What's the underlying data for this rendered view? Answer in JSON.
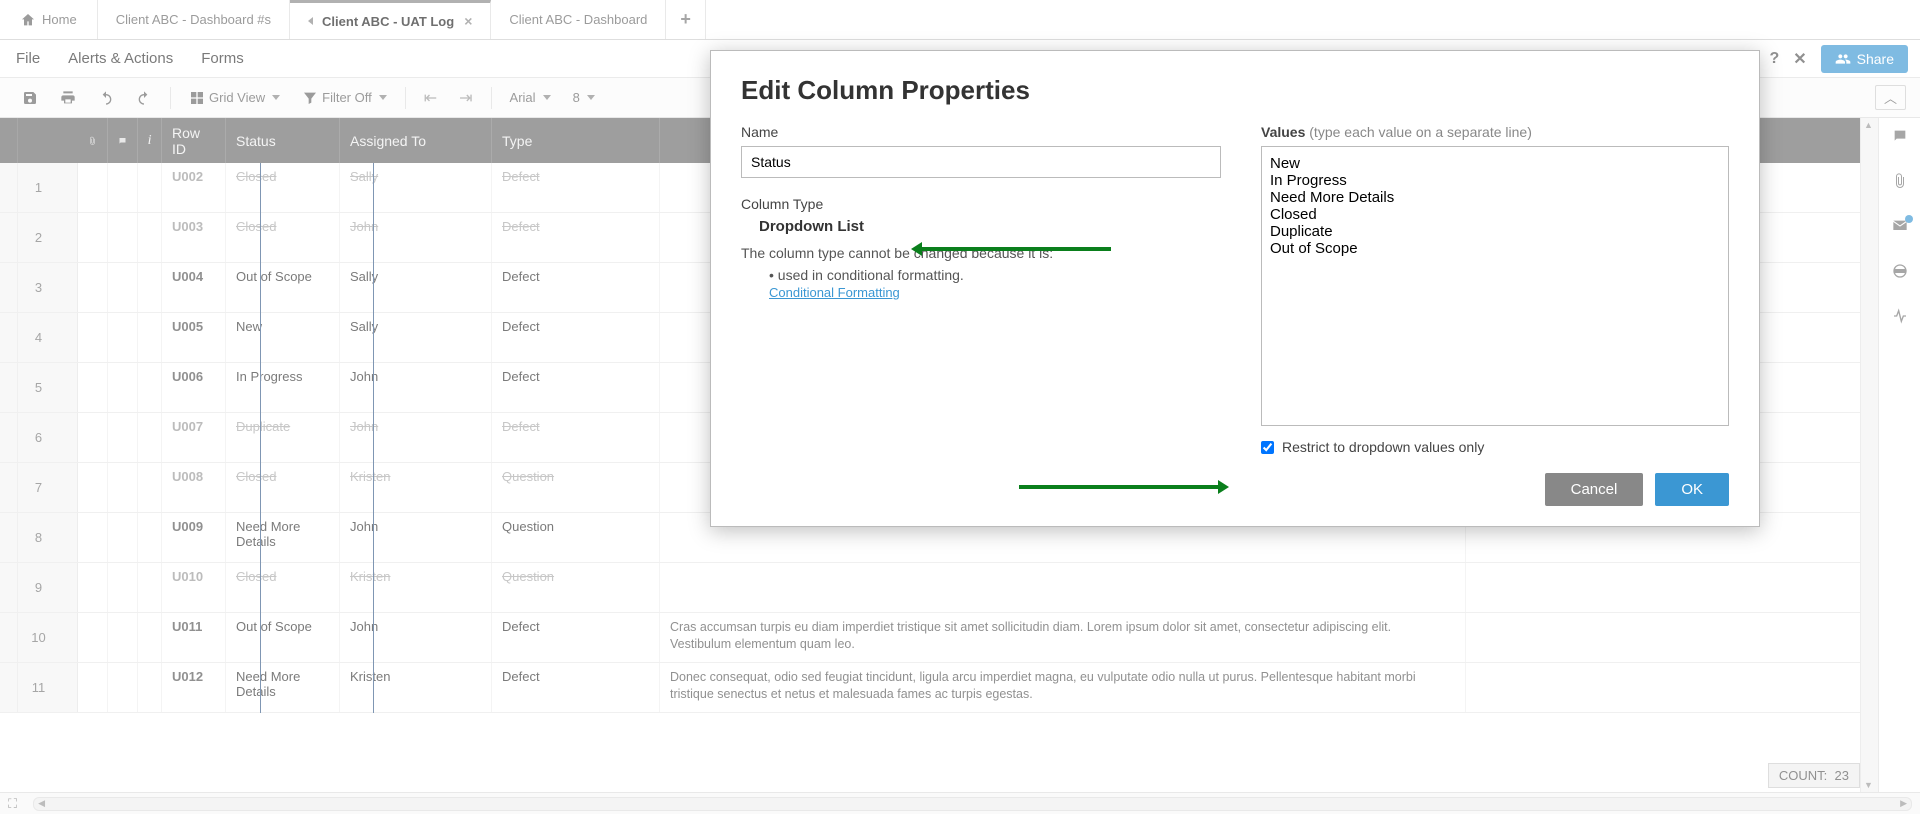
{
  "tabs": {
    "home": "Home",
    "t1": "Client ABC - Dashboard #s",
    "t2": "Client ABC - UAT Log",
    "t3": "Client ABC - Dashboard"
  },
  "menu": {
    "file": "File",
    "alerts": "Alerts & Actions",
    "forms": "Forms",
    "share": "Share"
  },
  "toolbar": {
    "grid_view": "Grid View",
    "filter_off": "Filter Off",
    "font": "Arial",
    "size": "8"
  },
  "headers": {
    "rowid": "Row ID",
    "status": "Status",
    "assigned": "Assigned To",
    "type": "Type"
  },
  "rows": [
    {
      "n": "1",
      "id": "U002",
      "status": "Closed",
      "assigned": "Sally",
      "type": "Defect",
      "closed": true,
      "desc": ""
    },
    {
      "n": "2",
      "id": "U003",
      "status": "Closed",
      "assigned": "John",
      "type": "Defect",
      "closed": true,
      "desc": ""
    },
    {
      "n": "3",
      "id": "U004",
      "status": "Out of Scope",
      "assigned": "Sally",
      "type": "Defect",
      "closed": false,
      "desc": ""
    },
    {
      "n": "4",
      "id": "U005",
      "status": "New",
      "assigned": "Sally",
      "type": "Defect",
      "closed": false,
      "desc": ""
    },
    {
      "n": "5",
      "id": "U006",
      "status": "In Progress",
      "assigned": "John",
      "type": "Defect",
      "closed": false,
      "desc": ""
    },
    {
      "n": "6",
      "id": "U007",
      "status": "Duplicate",
      "assigned": "John",
      "type": "Defect",
      "closed": true,
      "desc": ""
    },
    {
      "n": "7",
      "id": "U008",
      "status": "Closed",
      "assigned": "Kristen",
      "type": "Question",
      "closed": true,
      "desc": ""
    },
    {
      "n": "8",
      "id": "U009",
      "status": "Need More Details",
      "assigned": "John",
      "type": "Question",
      "closed": false,
      "desc": ""
    },
    {
      "n": "9",
      "id": "U010",
      "status": "Closed",
      "assigned": "Kristen",
      "type": "Question",
      "closed": true,
      "desc": ""
    },
    {
      "n": "10",
      "id": "U011",
      "status": "Out of Scope",
      "assigned": "John",
      "type": "Defect",
      "closed": false,
      "desc": "Cras accumsan turpis eu diam imperdiet tristique sit amet sollicitudin diam. Lorem ipsum dolor sit amet, consectetur adipiscing elit. Vestibulum elementum quam leo."
    },
    {
      "n": "11",
      "id": "U012",
      "status": "Need More Details",
      "assigned": "Kristen",
      "type": "Defect",
      "closed": false,
      "desc": "Donec consequat, odio sed feugiat tincidunt, ligula arcu imperdiet magna, eu vulputate odio nulla ut purus. Pellentesque habitant morbi tristique senectus et netus et malesuada fames ac turpis egestas."
    }
  ],
  "modal": {
    "title": "Edit Column Properties",
    "name_label": "Name",
    "name_value": "Status",
    "coltype_label": "Column Type",
    "coltype_value": "Dropdown List",
    "note": "The column type cannot be changed because it is:",
    "bullet": "• used in conditional formatting.",
    "link": "Conditional Formatting",
    "values_label": "Values",
    "values_hint": "(type each value on a separate line)",
    "values_text": "New\nIn Progress\nNeed More Details\nClosed\nDuplicate\nOut of Scope",
    "restrict_label": "Restrict to dropdown values only",
    "cancel": "Cancel",
    "ok": "OK"
  },
  "footer": {
    "count_label": "COUNT:",
    "count_value": "23"
  }
}
